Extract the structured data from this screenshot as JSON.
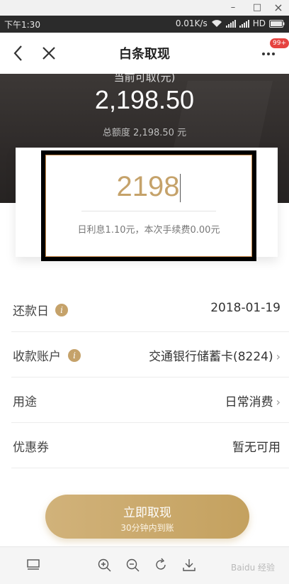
{
  "window": {
    "minimize": "–",
    "maximize": "□",
    "close": "×"
  },
  "status_bar": {
    "time": "下午1:30",
    "net_speed": "0.01K/s",
    "network_label": "HD",
    "battery_icon": "battery-icon"
  },
  "nav": {
    "title": "白条取现",
    "badge": "99+"
  },
  "hero": {
    "label": "当前可取(元)",
    "amount": "2,198.50",
    "total": "总额度 2,198.50 元"
  },
  "input": {
    "value": "2198",
    "fee_text": "日利息1.10元，本次手续费0.00元"
  },
  "rows": [
    {
      "label": "还款日",
      "value": "2018-01-19",
      "has_info": true,
      "has_chevron": false
    },
    {
      "label": "收款账户",
      "value": "交通银行储蓄卡(8224)",
      "has_info": true,
      "has_chevron": true
    },
    {
      "label": "用途",
      "value": "日常消费",
      "has_info": false,
      "has_chevron": true
    },
    {
      "label": "优惠券",
      "value": "暂无可用",
      "has_info": false,
      "has_chevron": false
    }
  ],
  "cta": {
    "main": "立即取现",
    "sub": "30分钟内到账"
  },
  "toolbar": {
    "watermark": "Baidu 经验"
  },
  "colors": {
    "accent": "#c5a26a",
    "badge": "#e64340",
    "hero_bg": "#2e2a29"
  }
}
